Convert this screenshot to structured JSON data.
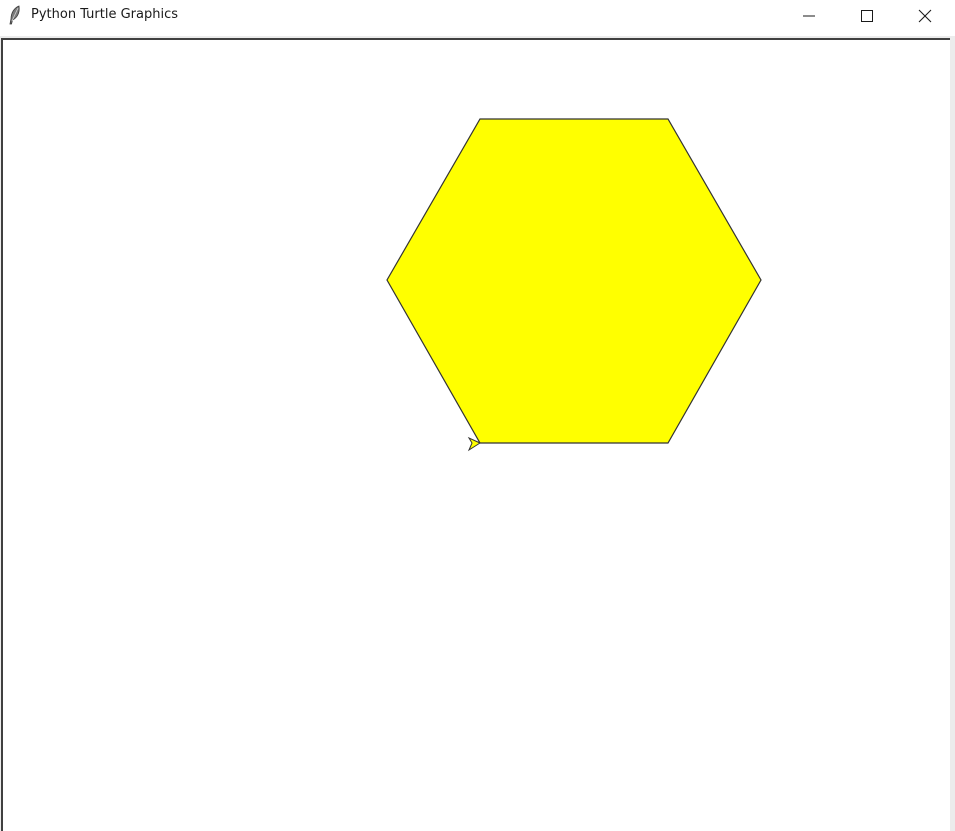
{
  "window": {
    "title": "Python Turtle Graphics",
    "icon": "feather-icon",
    "controls": [
      "minimize-icon",
      "maximize-icon",
      "close-icon"
    ]
  },
  "canvas": {
    "background": "#ffffff",
    "shape": {
      "type": "hexagon",
      "fill_color": "#ffff00",
      "stroke_color": "#333333"
    },
    "turtle": {
      "shape": "classic-arrow",
      "fill_color": "#ffff00",
      "stroke_color": "#333333",
      "heading": "left"
    }
  }
}
